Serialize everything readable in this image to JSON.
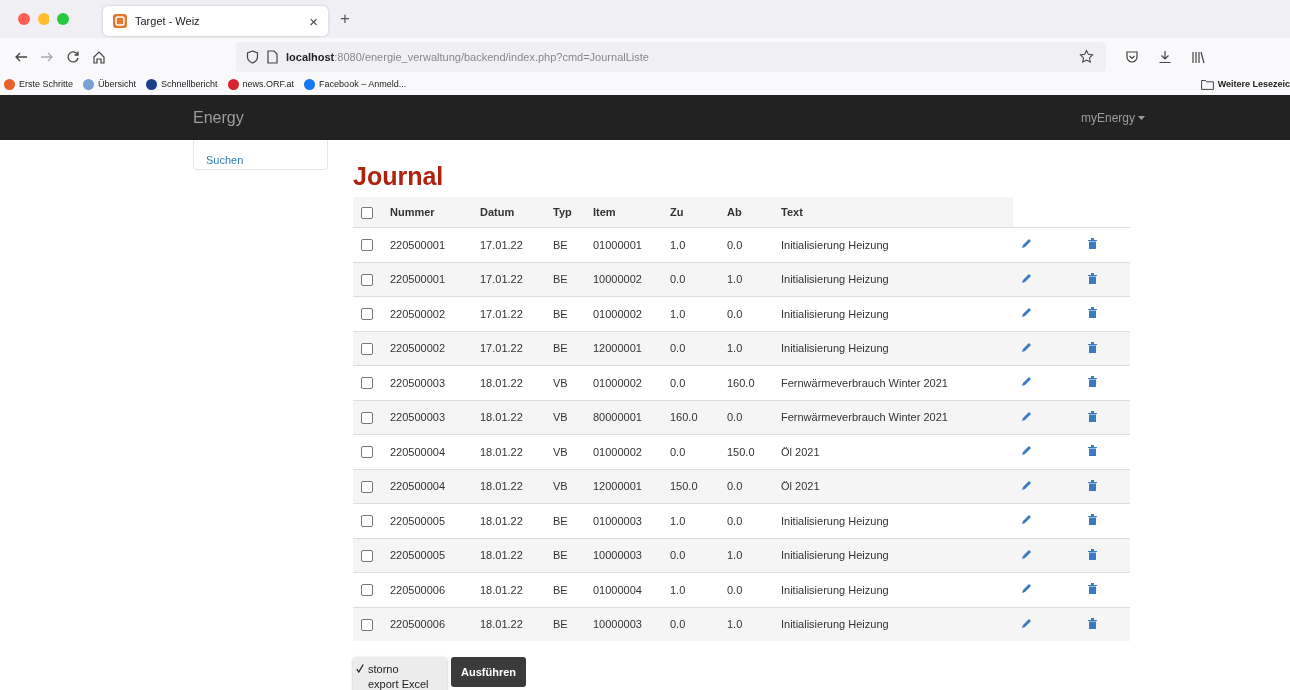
{
  "browser": {
    "tab": {
      "title": "Target - Weiz",
      "close": "×"
    },
    "new_tab": "+",
    "url": "**localhost**:8080/energie_verwaltung/backend/index.php?cmd=JournalListe",
    "bookmarks": [
      {
        "label": "Erste Schritte",
        "color": "#e8612c"
      },
      {
        "label": "Übersicht",
        "color": "#7aa0d8"
      },
      {
        "label": "Schnellbericht",
        "color": "#1d3f8c"
      },
      {
        "label": "news.ORF.at",
        "color": "#d8232a"
      },
      {
        "label": "Facebook – Anmeld...",
        "color": "#1877f2"
      }
    ],
    "other_bookmarks": "Weitere Lesezeic"
  },
  "navbar": {
    "brand": "Energy",
    "user_menu": "myEnergy"
  },
  "sidebar": {
    "items": [
      {
        "label": "Suchen"
      }
    ]
  },
  "title": "Journal",
  "table": {
    "all_checked": false,
    "columns": [
      "Nummer",
      "Datum",
      "Typ",
      "Item",
      "Zu",
      "Ab",
      "Text"
    ],
    "rows": [
      {
        "checked": false,
        "cells": [
          "220500001",
          "17.01.22",
          "BE",
          "01000001",
          "1.0",
          "0.0",
          "Initialisierung Heizung"
        ]
      },
      {
        "checked": false,
        "cells": [
          "220500001",
          "17.01.22",
          "BE",
          "10000002",
          "0.0",
          "1.0",
          "Initialisierung Heizung"
        ]
      },
      {
        "checked": false,
        "cells": [
          "220500002",
          "17.01.22",
          "BE",
          "01000002",
          "1.0",
          "0.0",
          "Initialisierung Heizung"
        ]
      },
      {
        "checked": false,
        "cells": [
          "220500002",
          "17.01.22",
          "BE",
          "12000001",
          "0.0",
          "1.0",
          "Initialisierung Heizung"
        ]
      },
      {
        "checked": false,
        "cells": [
          "220500003",
          "18.01.22",
          "VB",
          "01000002",
          "0.0",
          "160.0",
          "Fernwärmeverbrauch Winter 2021"
        ]
      },
      {
        "checked": false,
        "cells": [
          "220500003",
          "18.01.22",
          "VB",
          "80000001",
          "160.0",
          "0.0",
          "Fernwärmeverbrauch Winter 2021"
        ]
      },
      {
        "checked": false,
        "cells": [
          "220500004",
          "18.01.22",
          "VB",
          "01000002",
          "0.0",
          "150.0",
          "Öl 2021"
        ]
      },
      {
        "checked": false,
        "cells": [
          "220500004",
          "18.01.22",
          "VB",
          "12000001",
          "150.0",
          "0.0",
          "Öl 2021"
        ]
      },
      {
        "checked": false,
        "cells": [
          "220500005",
          "18.01.22",
          "BE",
          "01000003",
          "1.0",
          "0.0",
          "Initialisierung Heizung"
        ]
      },
      {
        "checked": false,
        "cells": [
          "220500005",
          "18.01.22",
          "BE",
          "10000003",
          "0.0",
          "1.0",
          "Initialisierung Heizung"
        ]
      },
      {
        "checked": false,
        "cells": [
          "220500006",
          "18.01.22",
          "BE",
          "01000004",
          "1.0",
          "0.0",
          "Initialisierung Heizung"
        ]
      },
      {
        "checked": false,
        "cells": [
          "220500006",
          "18.01.22",
          "BE",
          "10000003",
          "0.0",
          "1.0",
          "Initialisierung Heizung"
        ]
      }
    ]
  },
  "action_menu": {
    "options": [
      {
        "label": "storno",
        "selected": true
      },
      {
        "label": "export Excel",
        "selected": false
      }
    ]
  },
  "submit_button": "Ausführen"
}
